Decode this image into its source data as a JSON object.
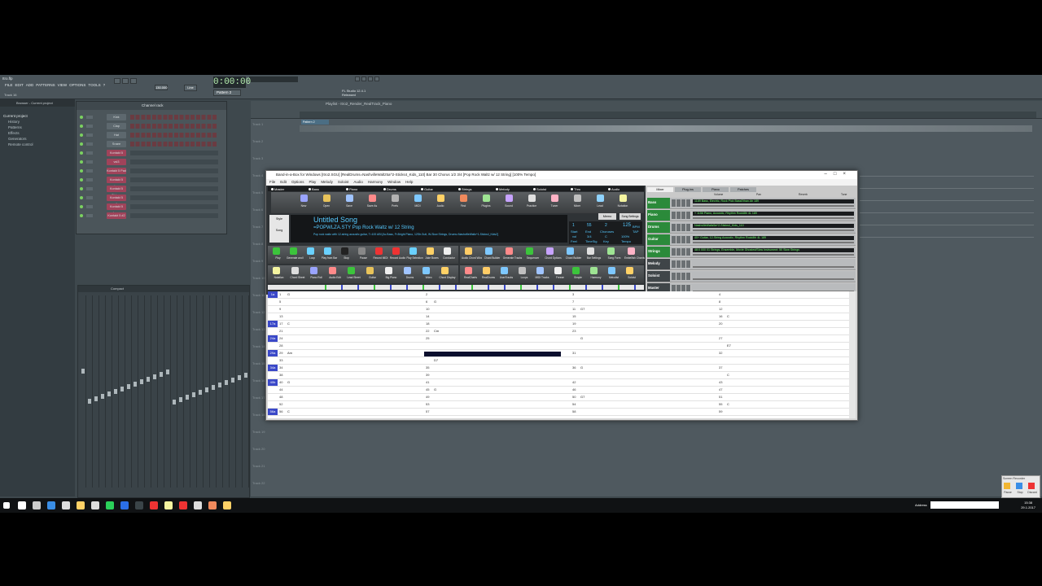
{
  "fl": {
    "menu": [
      "FILE",
      "EDIT",
      "ADD",
      "PATTERNS",
      "VIEW",
      "OPTIONS",
      "TOOLS",
      "?"
    ],
    "title": "Itro.flp",
    "hint": "Track 16",
    "time": "0:00:00",
    "pattern": "Pattern 2",
    "line": "Line",
    "tempo_label": "130.000",
    "version": "FL Studio 12.4.1",
    "version_sub": "Released",
    "browser_label": "Browser - Current project",
    "browser_items": [
      "Current project",
      "History",
      "Patterns",
      "Effects",
      "Generators",
      "Remote control"
    ],
    "rack_title": "Channel rack",
    "rack_filter": "All",
    "rack_swing": "Swing",
    "channels": [
      "Kick",
      "Clap",
      "Hat",
      "Snare",
      "Kontakt 5",
      "vst3",
      "Kontakt 5 Pad",
      "Kontakt 5 piano",
      "Kontakt 5 Strings",
      "Kontakt 5 guitar",
      "Kontakt 5 bass",
      "Kontakt 5 #2"
    ],
    "mixer_title": "Compact",
    "playlist_title": "Playlist - Itro2_Render_RealTrack_Piano",
    "pattern_block": "Pattern 2",
    "tracks": [
      "Track 1",
      "Track 2",
      "Track 3",
      "Track 4",
      "Track 5",
      "Track 6",
      "Track 7",
      "Track 8",
      "Track 9",
      "Track 10",
      "Track 11",
      "Track 12",
      "Track 13",
      "Track 14",
      "Track 15",
      "Track 16",
      "Track 17",
      "Track 18",
      "Track 19",
      "Track 20",
      "Track 21",
      "Track 22"
    ]
  },
  "biab": {
    "title": "Band-in-a-Box for Windows  [Itro2.SGU] [RealDrums=NashvilleWaltz5a^2-Sticks4_Kids_110] Bar 30 Chorus 1/2  3/4 [Pop Rock Waltz w/ 12 String] [100% Tempo]",
    "menu": [
      "File",
      "Edit",
      "Options",
      "Play",
      "Melody",
      "Soloist",
      "Audio",
      "Harmony",
      "Window",
      "Help"
    ],
    "tabs": [
      "Master",
      "Bass",
      "Piano",
      "Drums",
      "Guitar",
      "Strings",
      "Melody",
      "Soloist",
      "Thru",
      "Audio"
    ],
    "toolbar": [
      "New",
      "Open",
      "Save",
      "Save As",
      "Prefs",
      "MIDI",
      "Audio",
      "Find",
      "Plugins",
      "Sound",
      "Practice",
      "Tuner",
      "Mixer",
      "Lead",
      "Notation"
    ],
    "song_title": "Untitled Song",
    "style_line": "=POPWLZA.STY Pop Rock Waltz w/ 12 String",
    "style_desc": "Pop rock waltz with 12-string acoustic guitar, T=100 ABI     [Ac.Bass, Fr.Bright Piano, 12Str.Guit, W-Slow Strings, Drums=NashvilleWaltz^1-Sticks4_Kids2]",
    "memo": "Memo",
    "song_settings": "Song Settings",
    "style_label": "Style",
    "song_label": "Song",
    "lcd": {
      "start": "1",
      "end": "55",
      "choruses": "2",
      "time_sig": "3/4",
      "key": "C",
      "tempo": "125",
      "start_lbl": "Start",
      "end_lbl": "End",
      "ch_lbl": "Choruses",
      "ts_lbl": "TimeSig",
      "key_lbl": "Key",
      "tempo_lbl": "Tempo",
      "feel": "Feel",
      "bpm": "BPM",
      "tap": "TAP",
      "pct": "100%",
      "fv": "vol"
    },
    "transport": [
      "Play",
      "Generate and Play",
      "Loop",
      "Play from Bar",
      "Stop",
      "Pause",
      "Record MIDI",
      "Record Audio",
      "Play Selection",
      "Juke Boxes",
      "Conductor"
    ],
    "tools": [
      "Audio Chord Wizard",
      "Chord Builder",
      "Generate Tracks",
      "Sequencer",
      "Chord Options",
      "Chord Builder",
      "Bar Settings",
      "Song Form",
      "Embellish Chords"
    ],
    "view": [
      "Notation",
      "Chord Sheet",
      "Piano Roll",
      "Audio Edit",
      "Lead Sheet",
      "Guitar",
      "Big Piano",
      "Drums",
      "Video",
      "Chord Display"
    ],
    "realtrack_btns": [
      "RealCharts",
      "RealDrums",
      "UserTracks",
      "Loops",
      "MIDI Tracks",
      "Freeze",
      "Simple",
      "Harmony",
      "Melodist",
      "Soloist"
    ],
    "mixer_tabs": [
      "Mixer",
      "Plug-ins",
      "Piano",
      "Patches"
    ],
    "mixer_cols": [
      "Volume",
      "Pan",
      "Reverb",
      "Tone"
    ],
    "mixer_rows": [
      {
        "name": "Bass",
        "inst": "1189 Bass, Electric, Rock Pick BassEthan Ab 189"
      },
      {
        "name": "Piano",
        "inst": "+ 1156 Piano, Acoustic, Rhythm Rock8th 4L 189"
      },
      {
        "name": "Drums",
        "inst": "NashvilleWaltz5a^2-Sticks4_Kids_110"
      },
      {
        "name": "Guitar",
        "inst": "40+ Guitar, 12-String Acoustic, Rhythm Rock8th 4L 189"
      },
      {
        "name": "Strings",
        "inst": "48:0 000 01 Strings, Ensemble, Movie Ghosted/Slow Instrument: 50 Slow Strings"
      },
      {
        "name": "Melody",
        "inst": ""
      },
      {
        "name": "Soloist",
        "inst": ""
      },
      {
        "name": "Master",
        "inst": ""
      }
    ],
    "master_labels": [
      "Drive Control",
      "All Songs"
    ],
    "grid": {
      "rows": [
        {
          "sec": "1a",
          "cells": [
            "1",
            "2",
            "3",
            "4"
          ]
        },
        {
          "sec": "",
          "cells": [
            "5",
            "6",
            "7",
            "8"
          ]
        },
        {
          "sec": "",
          "cells": [
            "9",
            "10",
            "11",
            "12"
          ]
        },
        {
          "sec": "",
          "cells": [
            "13",
            "14",
            "15",
            "16"
          ]
        },
        {
          "sec": "17a",
          "cells": [
            "17",
            "18",
            "19",
            "20"
          ]
        },
        {
          "sec": "",
          "cells": [
            "21",
            "22",
            "23",
            ""
          ]
        },
        {
          "sec": "24a",
          "cells": [
            "24",
            "25",
            "",
            "27"
          ]
        },
        {
          "sec": "",
          "cells": [
            "28",
            "",
            "",
            ""
          ]
        },
        {
          "sec": "29a",
          "cells": [
            "29",
            "30",
            "31",
            "32"
          ]
        },
        {
          "sec": "",
          "cells": [
            "33",
            "",
            "",
            ""
          ]
        },
        {
          "sec": "34a",
          "cells": [
            "34",
            "35",
            "36",
            "37"
          ]
        },
        {
          "sec": "",
          "cells": [
            "38",
            "39",
            "",
            ""
          ]
        },
        {
          "sec": "40b",
          "cells": [
            "40",
            "41",
            "42",
            "43"
          ]
        },
        {
          "sec": "",
          "cells": [
            "44",
            "45",
            "46",
            "47"
          ]
        },
        {
          "sec": "",
          "cells": [
            "48",
            "49",
            "50",
            "51"
          ]
        },
        {
          "sec": "",
          "cells": [
            "52",
            "53",
            "54",
            "55"
          ]
        },
        {
          "sec": "56a",
          "cells": [
            "56",
            "57",
            "58",
            "59"
          ]
        }
      ],
      "chords": [
        "G",
        "G",
        "G7",
        "C",
        "C",
        "Cm",
        "G",
        "E7",
        "Am",
        "D7",
        "G",
        "C"
      ]
    }
  },
  "taskbar": {
    "address": "Address",
    "time": "15:38",
    "date": "29.1.2017",
    "popup": [
      "Pause",
      "Stop",
      "Discard"
    ],
    "popup_title": "Screen Recorder"
  },
  "colors": {
    "accent": "#56c9ff",
    "flbg": "#4f595f",
    "section": "#3a48c8",
    "selection": "#0b0f2e"
  }
}
